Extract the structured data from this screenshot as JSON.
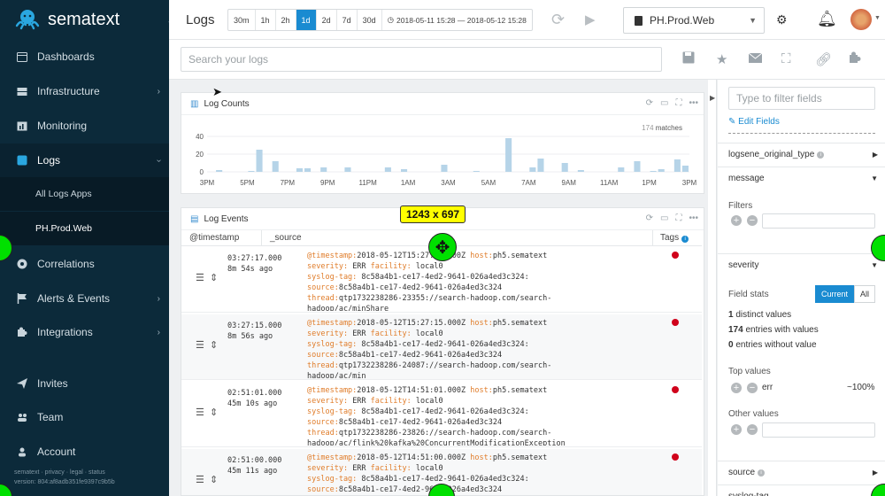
{
  "brand": {
    "name": "sematext"
  },
  "sidebar": {
    "items": [
      {
        "label": "Dashboards",
        "icon": "dashboard-icon"
      },
      {
        "label": "Infrastructure",
        "icon": "server-icon"
      },
      {
        "label": "Monitoring",
        "icon": "chart-icon"
      },
      {
        "label": "Logs",
        "icon": "logs-icon"
      },
      {
        "label": "Correlations",
        "icon": "globe-icon"
      },
      {
        "label": "Alerts & Events",
        "icon": "flag-icon"
      },
      {
        "label": "Integrations",
        "icon": "puzzle-icon"
      },
      {
        "label": "Invites",
        "icon": "send-icon"
      },
      {
        "label": "Team",
        "icon": "team-icon"
      },
      {
        "label": "Account",
        "icon": "user-icon"
      }
    ],
    "sub_items": [
      {
        "label": "All Logs Apps"
      },
      {
        "label": "PH.Prod.Web"
      }
    ],
    "footer_links": "sematext · privacy · legal · status",
    "footer_version": "version: 804:af8adb351fe9397c9b5b"
  },
  "topbar": {
    "title": "Logs",
    "ranges": [
      "30m",
      "1h",
      "2h",
      "1d",
      "2d",
      "7d",
      "30d"
    ],
    "active_range": "1d",
    "date_range": "2018-05-11 15:28 — 2018-05-12 15:28",
    "app_selected": "PH.Prod.Web"
  },
  "search": {
    "placeholder": "Search your logs"
  },
  "log_counts": {
    "title": "Log Counts",
    "matches_num": "174",
    "matches_label": "matches"
  },
  "chart_data": {
    "type": "bar",
    "x": [
      "3PM",
      "5PM",
      "7PM",
      "9PM",
      "11PM",
      "1AM",
      "3AM",
      "5AM",
      "7AM",
      "9AM",
      "11AM",
      "1PM",
      "3PM"
    ],
    "values": [
      0,
      2,
      0,
      0,
      0,
      1,
      25,
      0,
      12,
      0,
      0,
      4,
      4,
      0,
      5,
      0,
      0,
      5,
      0,
      0,
      0,
      0,
      5,
      0,
      3,
      0,
      0,
      0,
      0,
      8,
      0,
      0,
      0,
      1,
      0,
      0,
      0,
      38,
      0,
      0,
      5,
      15,
      0,
      0,
      10,
      0,
      2,
      0,
      0,
      0,
      0,
      5,
      0,
      12,
      0,
      1,
      3,
      0,
      14,
      7
    ],
    "ylim": [
      0,
      40
    ],
    "yticks": [
      0,
      20,
      40
    ],
    "color": "#b6d4e8"
  },
  "log_events": {
    "title": "Log Events",
    "columns": [
      "@timestamp",
      "_source",
      "Tags"
    ],
    "rows": [
      {
        "time": "03:27:17.000",
        "ago": "8m 54s ago",
        "ts": "2018-05-12T15:27:17.000Z",
        "host": "ph5.sematext",
        "severity": "ERR",
        "facility": "local0",
        "tag": "8c58a4b1-ce17-4ed2-9641-026a4ed3c324:",
        "source": "8c58a4b1-ce17-4ed2-9641-026a4ed3c324",
        "thread": "qtp1732238286-23355://search-hadoop.com/search-hadoop/ac/minShare"
      },
      {
        "time": "03:27:15.000",
        "ago": "8m 56s ago",
        "ts": "2018-05-12T15:27:15.000Z",
        "host": "ph5.sematext",
        "severity": "ERR",
        "facility": "local0",
        "tag": "8c58a4b1-ce17-4ed2-9641-026a4ed3c324:",
        "source": "8c58a4b1-ce17-4ed2-9641-026a4ed3c324",
        "thread": "qtp1732238286-24087://search-hadoop.com/search-hadoop/ac/min"
      },
      {
        "time": "02:51:01.000",
        "ago": "45m 10s ago",
        "ts": "2018-05-12T14:51:01.000Z",
        "host": "ph5.sematext",
        "severity": "ERR",
        "facility": "local0",
        "tag": "8c58a4b1-ce17-4ed2-9641-026a4ed3c324:",
        "source": "8c58a4b1-ce17-4ed2-9641-026a4ed3c324",
        "thread": "qtp1732238286-23826://search-hadoop.com/search-hadoop/ac/flink%20kafka%20ConcurrentModificationException"
      },
      {
        "time": "02:51:00.000",
        "ago": "45m 11s ago",
        "ts": "2018-05-12T14:51:00.000Z",
        "host": "ph5.sematext",
        "severity": "ERR",
        "facility": "local0",
        "tag": "8c58a4b1-ce17-4ed2-9641-026a4ed3c324:",
        "source": "8c58a4b1-ce17-4ed2-9641-026a4ed3c324",
        "thread": ""
      }
    ]
  },
  "overlay": {
    "size_label": "1243 x 697"
  },
  "right_panel": {
    "filter_placeholder": "Type to filter fields",
    "edit_fields": "Edit Fields",
    "fields": [
      {
        "name": "logsene_original_type"
      },
      {
        "name": "message"
      },
      {
        "name": "severity"
      },
      {
        "name": "source"
      },
      {
        "name": "syslog-tag"
      }
    ],
    "filters_label": "Filters",
    "field_stats_label": "Field stats",
    "stats_current": "Current",
    "stats_all": "All",
    "distinct": "1",
    "distinct_label": "distinct values",
    "with_values": "174",
    "with_values_label": "entries with values",
    "without": "0",
    "without_label": "entries without value",
    "top_values_label": "Top values",
    "top_value": "err",
    "top_value_pct": "~100%",
    "other_values_label": "Other values"
  }
}
